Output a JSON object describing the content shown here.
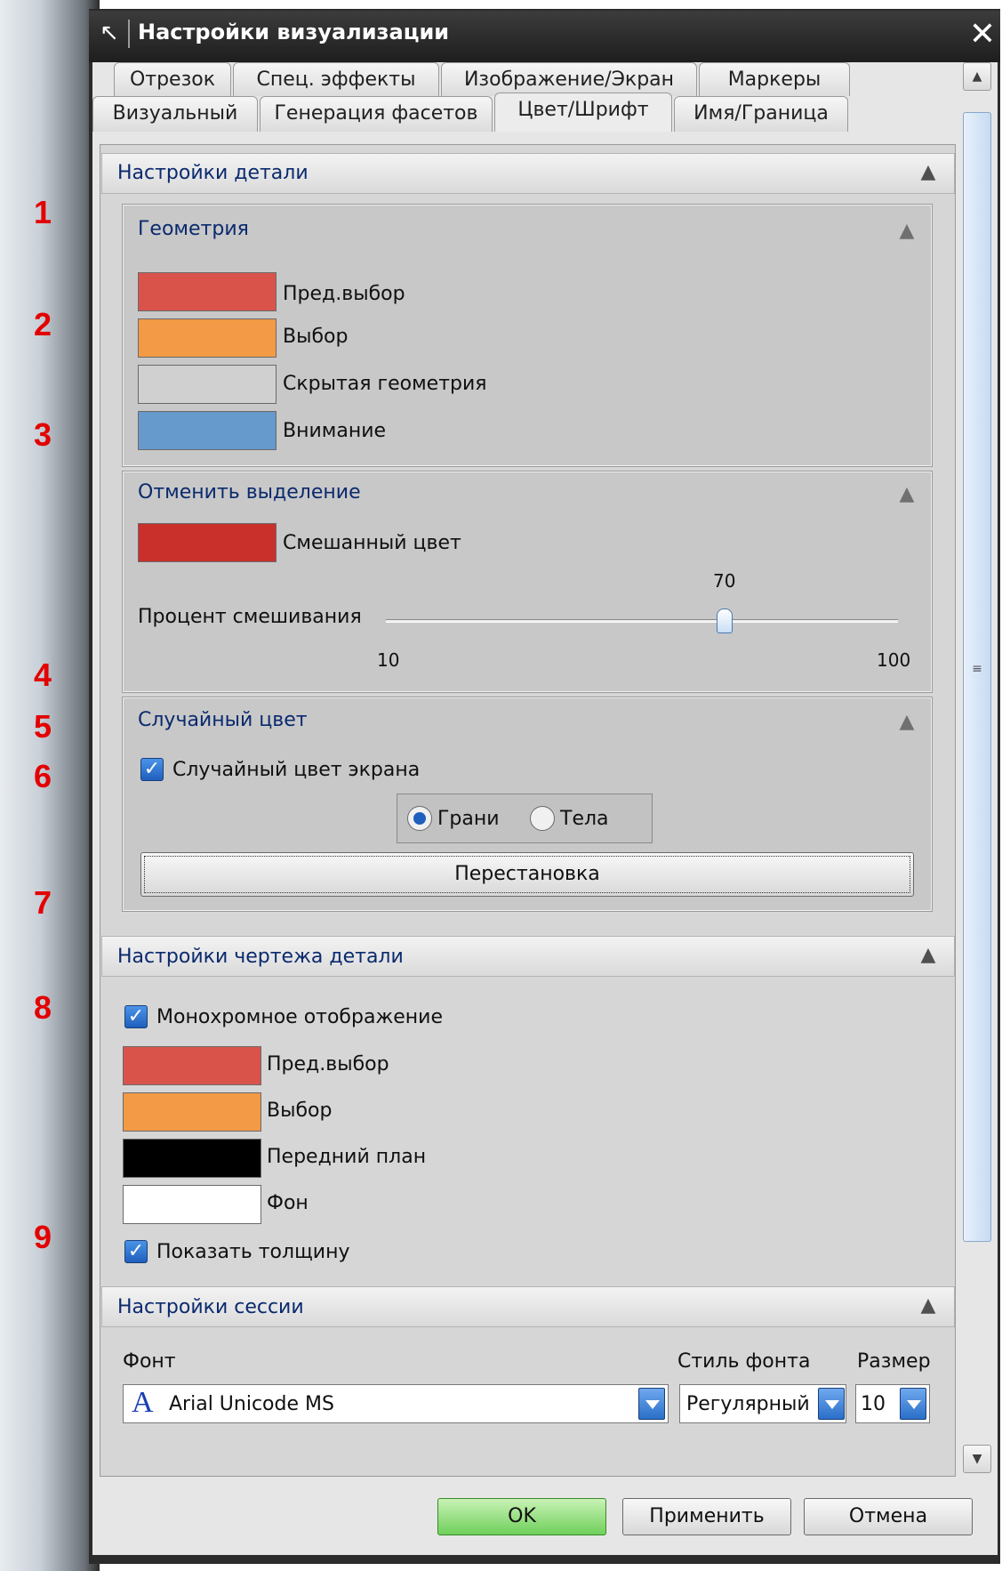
{
  "window": {
    "title": "Настройки визуализации"
  },
  "annotations": [
    "1",
    "2",
    "3",
    "4",
    "5",
    "6",
    "7",
    "8",
    "9"
  ],
  "tabs": {
    "row1": [
      "Отрезок",
      "Спец. эффекты",
      "Изображение/Экран",
      "Маркеры"
    ],
    "row2": [
      "Визуальный",
      "Генерация фасетов",
      "Цвет/Шрифт",
      "Имя/Граница"
    ],
    "active": "Цвет/Шрифт"
  },
  "part_settings": {
    "title": "Настройки детали",
    "geometry": {
      "title": "Геометрия",
      "items": [
        {
          "label": "Пред.выбор",
          "color": "#d9534a"
        },
        {
          "label": "Выбор",
          "color": "#f29a45"
        },
        {
          "label": "Скрытая геометрия",
          "color": "#d0d0d0"
        },
        {
          "label": "Внимание",
          "color": "#6699cc"
        }
      ]
    },
    "deselect": {
      "title": "Отменить выделение",
      "blend_color": {
        "label": "Смешанный цвет",
        "color": "#c9302c"
      },
      "blend_percent": {
        "label": "Процент смешивания",
        "value": "70",
        "min": "10",
        "max": "100"
      }
    },
    "random_color": {
      "title": "Случайный цвет",
      "checkbox": {
        "label": "Случайный цвет экрана",
        "checked": true
      },
      "radios": [
        {
          "label": "Грани",
          "selected": true
        },
        {
          "label": "Тела",
          "selected": false
        }
      ],
      "shuffle_button": "Перестановка"
    }
  },
  "drawing_settings": {
    "title": "Настройки чертежа детали",
    "monochrome": {
      "label": "Монохромное отображение",
      "checked": true
    },
    "items": [
      {
        "label": "Пред.выбор",
        "color": "#d9534a"
      },
      {
        "label": "Выбор",
        "color": "#f29a45"
      },
      {
        "label": "Передний план",
        "color": "#000000"
      },
      {
        "label": "Фон",
        "color": "#ffffff"
      }
    ],
    "show_thickness": {
      "label": "Показать толщину",
      "checked": true
    }
  },
  "session_settings": {
    "title": "Настройки сессии",
    "font_label": "Фонт",
    "font_value": "Arial Unicode MS",
    "font_icon": "A",
    "style_label": "Стиль фонта",
    "style_value": "Регулярный",
    "size_label": "Размер",
    "size_value": "10"
  },
  "buttons": {
    "ok": "OK",
    "apply": "Применить",
    "cancel": "Отмена"
  }
}
